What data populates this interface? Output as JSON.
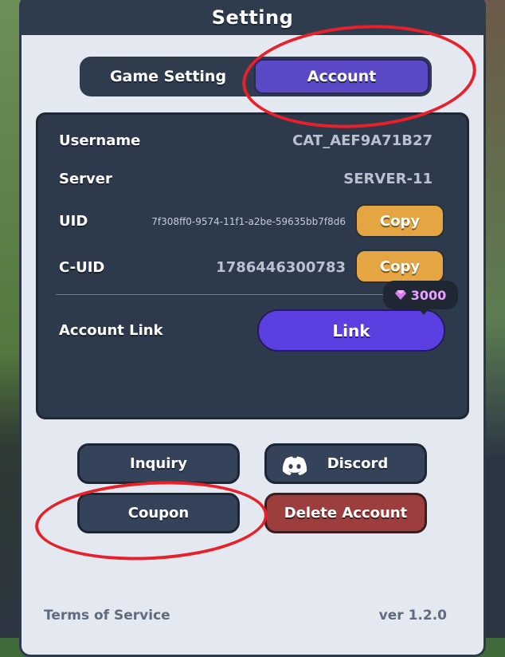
{
  "window": {
    "title": "Setting"
  },
  "tabs": [
    {
      "label": "Game Setting",
      "active": false
    },
    {
      "label": "Account",
      "active": true
    }
  ],
  "account": {
    "username": {
      "label": "Username",
      "value": "CAT_AEF9A71B27"
    },
    "server": {
      "label": "Server",
      "value": "SERVER-11"
    },
    "uid": {
      "label": "UID",
      "value": "7f308ff0-9574-11f1-a2be-59635bb7f8d6",
      "copy_label": "Copy"
    },
    "cuid": {
      "label": "C-UID",
      "value": "1786446300783",
      "copy_label": "Copy"
    },
    "link": {
      "label": "Account Link",
      "button_label": "Link",
      "gem_cost": "3000"
    }
  },
  "actions": {
    "inquiry": "Inquiry",
    "discord": "Discord",
    "coupon": "Coupon",
    "delete_account": "Delete Account"
  },
  "footer": {
    "terms": "Terms of Service",
    "version": "ver 1.2.0"
  },
  "colors": {
    "accent": "#5a4ac6",
    "copy": "#e4a542",
    "link": "#5b3fe0",
    "danger": "#9c3e3e",
    "highlight": "#e8202a"
  }
}
